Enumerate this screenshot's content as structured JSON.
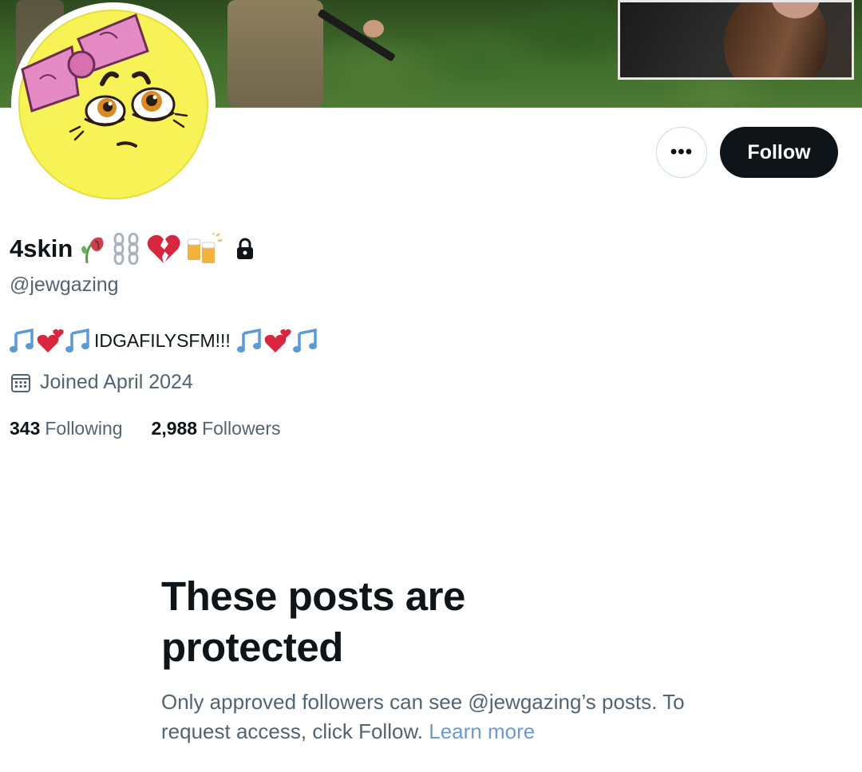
{
  "banner": {
    "icon": "header-photo"
  },
  "avatar": {
    "icon": "avatar-crying-face-with-bow"
  },
  "actions": {
    "more_label": "•••",
    "follow_label": "Follow"
  },
  "profile": {
    "display_name": "4skin",
    "handle": "@jewgazing",
    "bio_text": "IDGAFILYSFM!!!",
    "joined": "Joined April 2024",
    "following_count": "343",
    "following_label": "Following",
    "followers_count": "2,988",
    "followers_label": "Followers"
  },
  "protected": {
    "title": "These posts are protected",
    "description": "Only approved followers can see @jewgazing’s posts. To request access, click Follow. ",
    "learn_more": "Learn more"
  },
  "colors": {
    "text_primary": "#0f1419",
    "text_secondary": "#536471",
    "link": "#6b9bd2",
    "button_dark": "#0f1419"
  }
}
